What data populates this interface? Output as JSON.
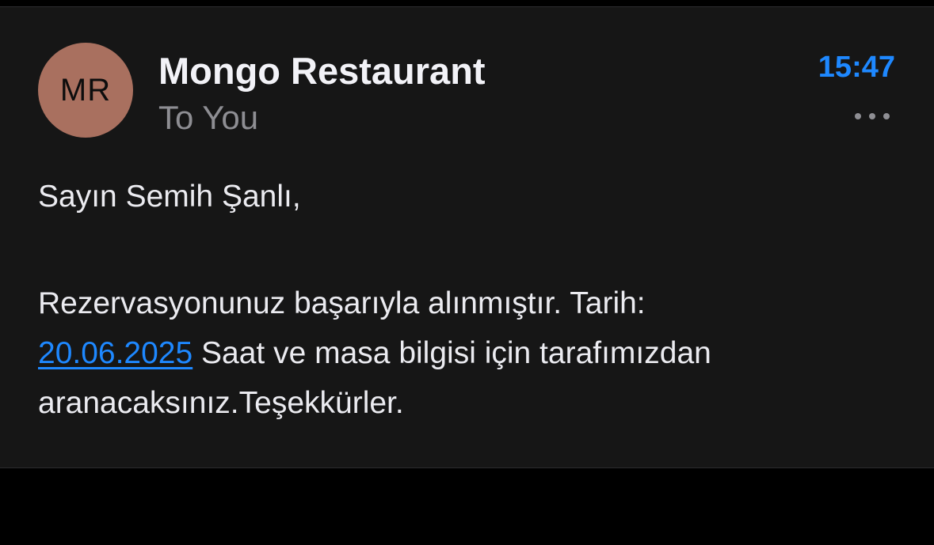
{
  "email": {
    "avatar_initials": "MR",
    "sender_name": "Mongo Restaurant",
    "recipient_line": "To You",
    "time": "15:47",
    "greeting": "Sayın Semih Şanlı,",
    "body_intro": "Rezervasyonunuz başarıyla alınmıştır. Tarih:",
    "date_link": "20.06.2025",
    "body_rest": " Saat ve masa bilgisi için tarafımızdan aranacaksınız.Teşekkürler."
  },
  "icons": {
    "more": "more-horizontal-icon"
  },
  "colors": {
    "accent": "#1e88ff",
    "avatar": "#a9705f",
    "background": "#161616"
  }
}
